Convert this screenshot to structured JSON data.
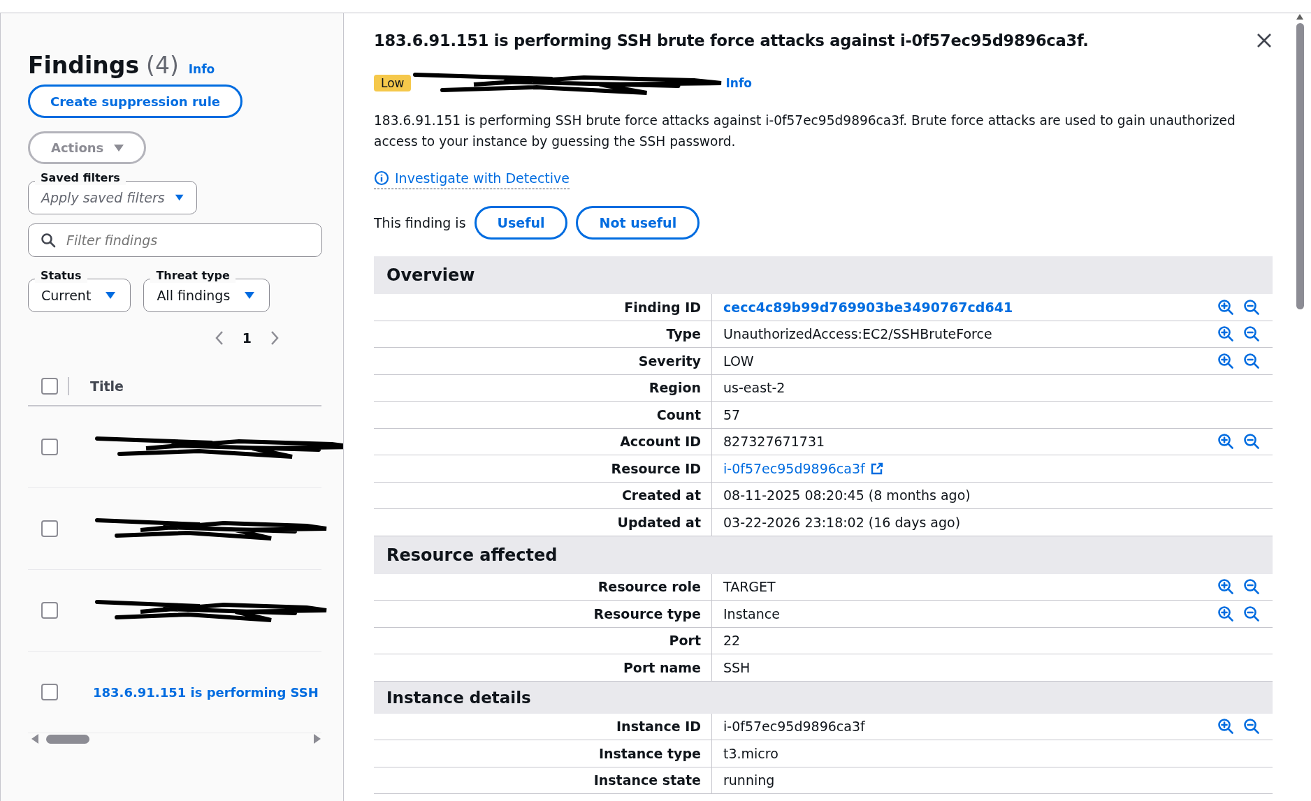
{
  "sidebar": {
    "title": "Findings",
    "count": "(4)",
    "info": "Info",
    "create_button": "Create suppression rule",
    "actions_button": {
      "label": "Actions",
      "disabled": true
    },
    "saved_filters": {
      "label": "Saved filters",
      "placeholder": "Apply saved filters"
    },
    "search": {
      "placeholder": "Filter findings"
    },
    "filters": [
      {
        "label": "Status",
        "value": "Current"
      },
      {
        "label": "Threat type",
        "value": "All findings"
      }
    ],
    "pagination": {
      "page": "1"
    },
    "table": {
      "column": "Title",
      "header_checked": false,
      "rows": [
        {
          "redacted": true,
          "checked": false
        },
        {
          "redacted": true,
          "checked": false
        },
        {
          "redacted": true,
          "checked": false
        },
        {
          "redacted": false,
          "title": "183.6.91.151 is performing SSH",
          "checked": false
        }
      ]
    }
  },
  "detail": {
    "title": "183.6.91.151 is performing SSH brute force attacks against i-0f57ec95d9896ca3f.",
    "severity_badge": "Low",
    "severity_note_redacted": true,
    "info": "Info",
    "description": "183.6.91.151 is performing SSH brute force attacks against i-0f57ec95d9896ca3f. Brute force attacks are used to gain unauthorized access to your instance by guessing the SSH password.",
    "investigate_link": "Investigate with Detective",
    "feedback": {
      "prompt": "This finding is",
      "buttons": [
        "Useful",
        "Not useful"
      ]
    },
    "sections": [
      {
        "title": "Overview",
        "rows": [
          {
            "label": "Finding ID",
            "value": "cecc4c89b99d769903be3490767cd641",
            "kind": "strong-link",
            "filter_actions": true
          },
          {
            "label": "Type",
            "value": "UnauthorizedAccess:EC2/SSHBruteForce",
            "kind": "text",
            "filter_actions": true
          },
          {
            "label": "Severity",
            "value": "LOW",
            "kind": "text",
            "filter_actions": true
          },
          {
            "label": "Region",
            "value": "us-east-2",
            "kind": "text",
            "filter_actions": false
          },
          {
            "label": "Count",
            "value": "57",
            "kind": "text",
            "filter_actions": false
          },
          {
            "label": "Account ID",
            "value": "827327671731",
            "kind": "text",
            "filter_actions": true
          },
          {
            "label": "Resource ID",
            "value": "i-0f57ec95d9896ca3f",
            "kind": "external-link",
            "filter_actions": false
          },
          {
            "label": "Created at",
            "value": "08-11-2025 08:20:45 (8 months ago)",
            "kind": "text",
            "filter_actions": false
          },
          {
            "label": "Updated at",
            "value": "03-22-2026 23:18:02 (16 days ago)",
            "kind": "text",
            "filter_actions": false
          }
        ]
      },
      {
        "title": "Resource affected",
        "rows": [
          {
            "label": "Resource role",
            "value": "TARGET",
            "kind": "text",
            "filter_actions": true
          },
          {
            "label": "Resource type",
            "value": "Instance",
            "kind": "text",
            "filter_actions": true
          },
          {
            "label": "Port",
            "value": "22",
            "kind": "text",
            "filter_actions": false
          },
          {
            "label": "Port name",
            "value": "SSH",
            "kind": "text",
            "filter_actions": false
          }
        ]
      },
      {
        "title": "Instance details",
        "rows": [
          {
            "label": "Instance ID",
            "value": "i-0f57ec95d9896ca3f",
            "kind": "text",
            "filter_actions": true
          },
          {
            "label": "Instance type",
            "value": "t3.micro",
            "kind": "text",
            "filter_actions": false
          },
          {
            "label": "Instance state",
            "value": "running",
            "kind": "text",
            "filter_actions": false
          }
        ]
      }
    ]
  }
}
